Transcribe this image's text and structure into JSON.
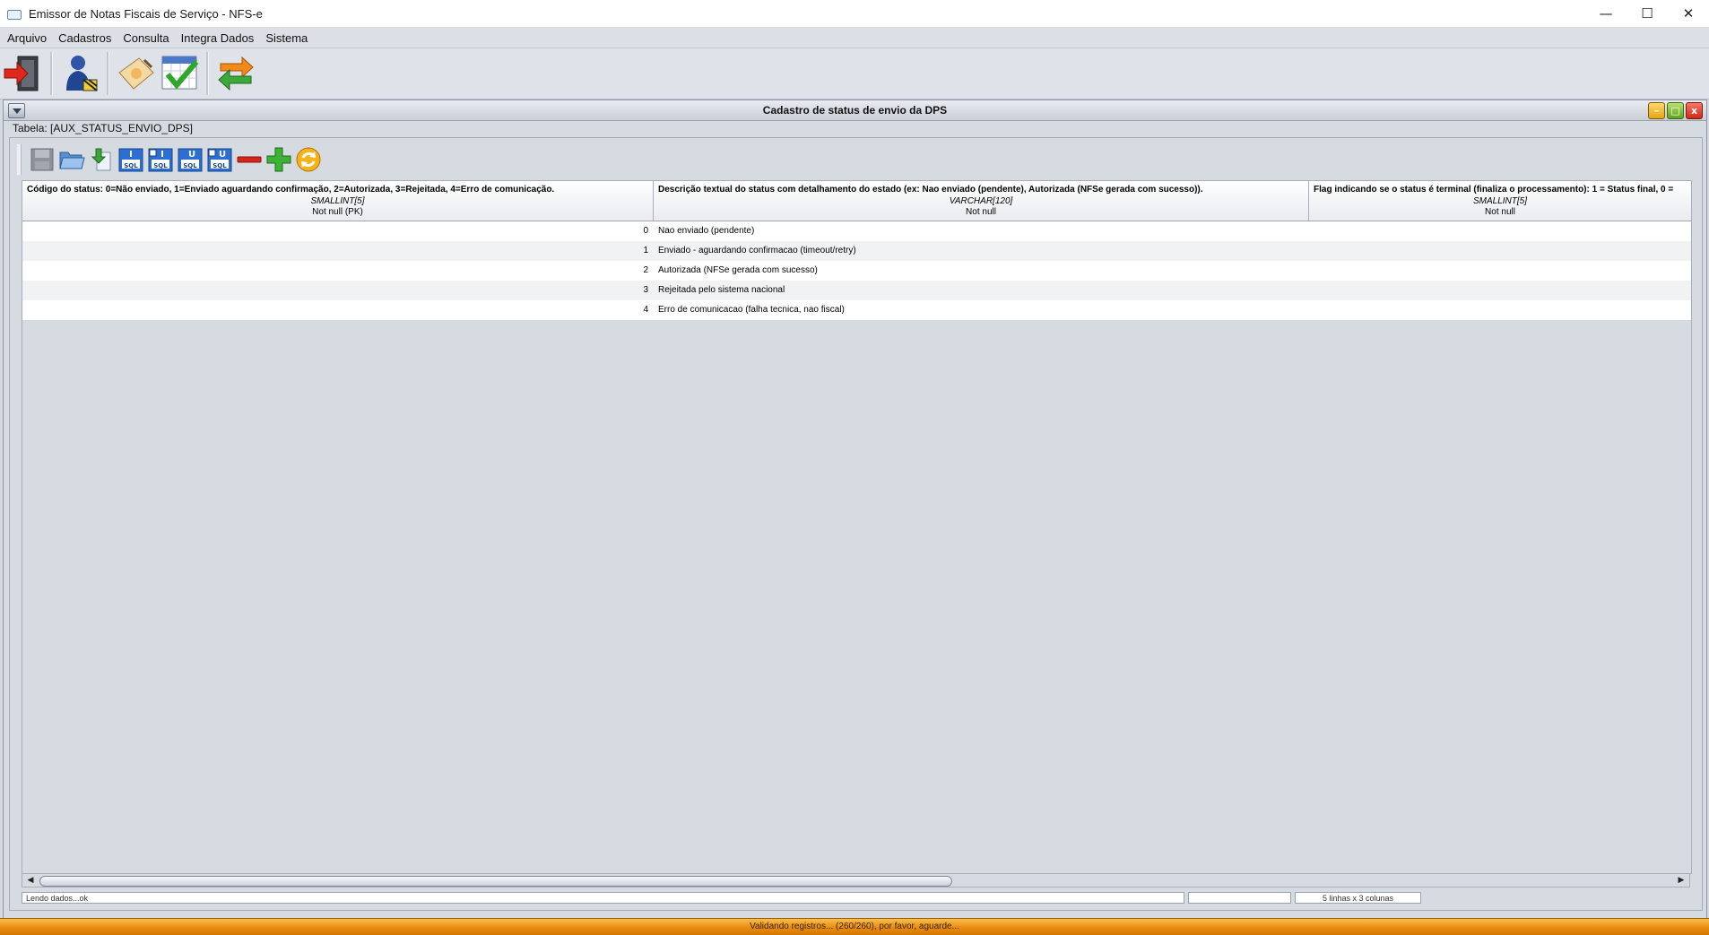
{
  "window": {
    "title": "Emissor de Notas Fiscais de Serviço - NFS-e",
    "controls": {
      "minimize": "—",
      "maximize": "☐",
      "close": "✕"
    }
  },
  "menubar": {
    "items": [
      "Arquivo",
      "Cadastros",
      "Consulta",
      "Integra Dados",
      "Sistema"
    ]
  },
  "main_toolbar": {
    "buttons": [
      {
        "icon": "exit-door-icon"
      },
      {
        "icon": "user-config-icon"
      },
      {
        "icon": "notepad-edit-icon"
      },
      {
        "icon": "calendar-check-icon"
      },
      {
        "icon": "sync-arrows-icon"
      }
    ]
  },
  "internal_frame": {
    "title": "Cadastro de status de envio da DPS",
    "table_label": "Tabela: [AUX_STATUS_ENVIO_DPS]",
    "buttons": {
      "minimize": "–",
      "maximize": "□",
      "close": "x"
    }
  },
  "inner_toolbar": {
    "buttons": [
      {
        "icon": "save-disk-icon",
        "enabled": false
      },
      {
        "icon": "open-folder-icon"
      },
      {
        "icon": "import-file-icon"
      },
      {
        "icon": "sql-insert-icon",
        "letter": "I",
        "text": "SQL"
      },
      {
        "icon": "sql-insert-all-icon",
        "letter": "I",
        "text": "SQL"
      },
      {
        "icon": "sql-update-icon",
        "letter": "U",
        "text": "SQL"
      },
      {
        "icon": "sql-update-all-icon",
        "letter": "U",
        "text": "SQL"
      },
      {
        "icon": "remove-minus-icon"
      },
      {
        "icon": "add-plus-icon"
      },
      {
        "icon": "refresh-icon"
      }
    ]
  },
  "grid": {
    "columns": [
      {
        "description": "Código do status: 0=Não enviado, 1=Enviado aguardando confirmação, 2=Autorizada, 3=Rejeitada, 4=Erro de comunicação.",
        "type": "SMALLINT[5]",
        "nullability": "Not null (PK)"
      },
      {
        "description": "Descrição textual do status com detalhamento do estado (ex: Nao enviado (pendente), Autorizada (NFSe gerada com sucesso)).",
        "type": "VARCHAR[120]",
        "nullability": "Not null"
      },
      {
        "description": "Flag indicando se o status é terminal (finaliza o processamento): 1 = Status final, 0 =",
        "type": "SMALLINT[5]",
        "nullability": "Not null"
      }
    ],
    "rows": [
      [
        "0",
        "Nao enviado (pendente)",
        ""
      ],
      [
        "1",
        "Enviado - aguardando confirmacao (timeout/retry)",
        ""
      ],
      [
        "2",
        "Autorizada (NFSe gerada com sucesso)",
        ""
      ],
      [
        "3",
        "Rejeitada pelo sistema nacional",
        ""
      ],
      [
        "4",
        "Erro de comunicacao (falha tecnica, nao fiscal)",
        ""
      ]
    ],
    "scroll": {
      "left": "◀",
      "right": "▶"
    }
  },
  "status_fields": {
    "message": "Lendo dados...ok",
    "middle": "",
    "counts": "5 linhas x 3 colunas"
  },
  "progress": {
    "text": "Validando registros... (260/260), por favor, aguarde...",
    "fraction": 1.0
  },
  "colors": {
    "progress_orange": "#e98c10",
    "frame_close": "#cf2a17",
    "frame_min": "#e6a513",
    "frame_max": "#5aa51d"
  }
}
